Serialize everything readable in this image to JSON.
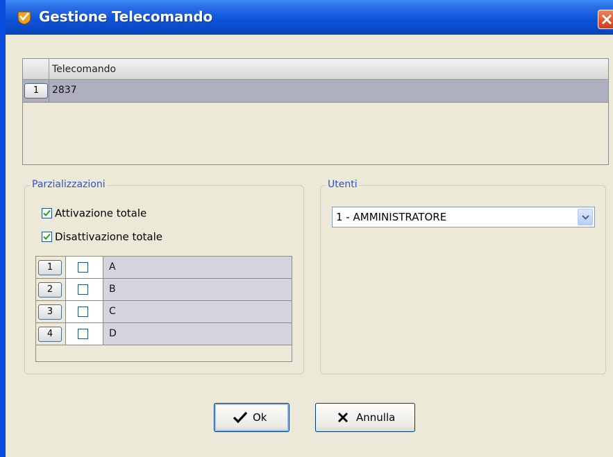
{
  "window": {
    "title": "Gestione Telecomando"
  },
  "telecomando_table": {
    "column_header": "Telecomando",
    "rows": [
      {
        "index": "1",
        "value": "2837"
      }
    ]
  },
  "parzializzazioni": {
    "label": "Parzializzazioni",
    "attivazione_totale": {
      "label": "Attivazione totale",
      "checked": true
    },
    "disattivazione_totale": {
      "label": "Disattivazione totale",
      "checked": true
    },
    "rows": [
      {
        "index": "1",
        "checked": false,
        "name": "A"
      },
      {
        "index": "2",
        "checked": false,
        "name": "B"
      },
      {
        "index": "3",
        "checked": false,
        "name": "C"
      },
      {
        "index": "4",
        "checked": false,
        "name": "D"
      }
    ]
  },
  "utenti": {
    "label": "Utenti",
    "selected": "1 - AMMINISTRATORE"
  },
  "buttons": {
    "ok_label": "Ok",
    "cancel_label": "Annulla"
  },
  "colors": {
    "titlebar": "#0d55d9",
    "group_label": "#2d53c6",
    "selected_row": "#aeb0bf",
    "check": "#21a121"
  },
  "icons": [
    "app-shield-icon",
    "close-icon",
    "checkmark-icon",
    "x-icon",
    "chevron-down-icon"
  ]
}
